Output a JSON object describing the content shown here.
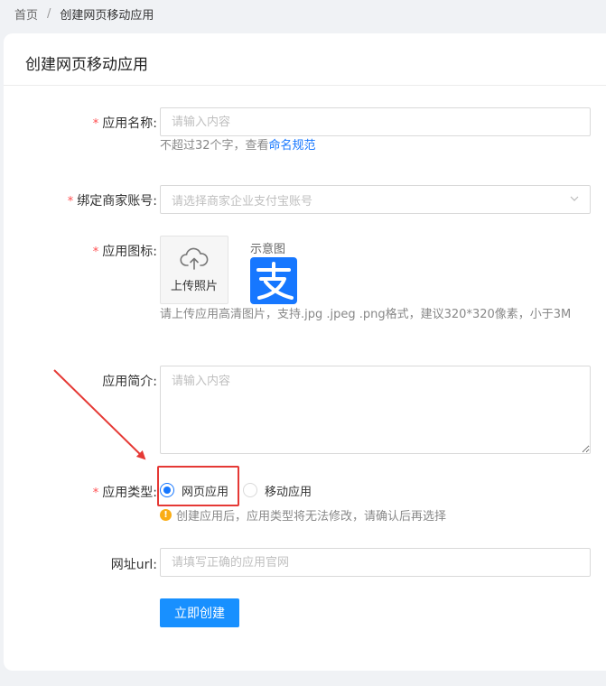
{
  "breadcrumb": {
    "home": "首页",
    "separator": "/",
    "current": "创建网页移动应用"
  },
  "page": {
    "title": "创建网页移动应用"
  },
  "form": {
    "required_mark": "*",
    "app_name": {
      "label": "应用名称:",
      "placeholder": "请输入内容",
      "help_prefix": "不超过32个字，查看",
      "help_link": "命名规范"
    },
    "merchant_account": {
      "label": "绑定商家账号:",
      "placeholder": "请选择商家企业支付宝账号"
    },
    "app_icon": {
      "label": "应用图标:",
      "upload_text": "上传照片",
      "sample_label": "示意图",
      "help": "请上传应用高清图片，支持.jpg .jpeg .png格式，建议320*320像素，小于3M"
    },
    "app_intro": {
      "label": "应用简介:",
      "placeholder": "请输入内容"
    },
    "app_type": {
      "label": "应用类型:",
      "options": [
        {
          "label": "网页应用",
          "checked": true
        },
        {
          "label": "移动应用",
          "checked": false
        }
      ],
      "warning": "创建应用后，应用类型将无法修改，请确认后再选择"
    },
    "website_url": {
      "label": "网址url:",
      "placeholder": "请填写正确的应用官网"
    },
    "submit_label": "立即创建"
  },
  "colors": {
    "primary": "#1890ff",
    "required": "#ff4d4f",
    "annotation": "#e53935",
    "warning": "#faad14",
    "alipay_blue": "#1677ff"
  },
  "icons": {
    "upload": "cloud-upload-icon",
    "select": "chevron-down-icon",
    "warning": "warning-circle-icon",
    "sample": "alipay-logo"
  }
}
